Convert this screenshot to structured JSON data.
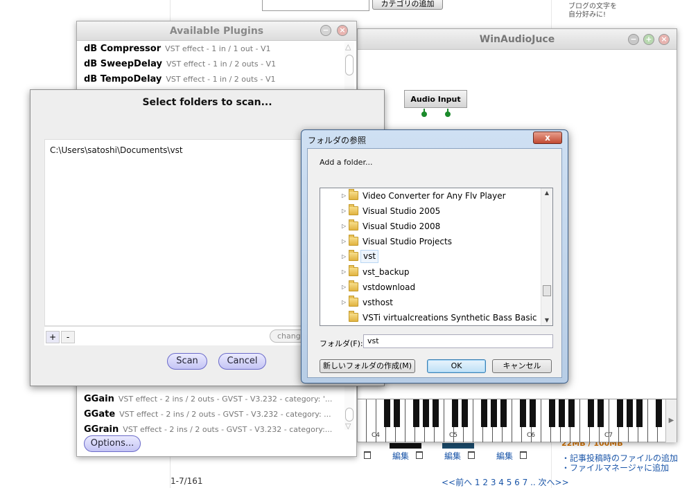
{
  "background_page": {
    "category_button": "カテゴリの追加",
    "ad_text_line1": "ブログの文字を",
    "ad_text_line2": "自分好みに!",
    "storage_text": "22MB / 100MB",
    "links": [
      "・記事投稿時のファイルの追加",
      "・ファイルマネージャに追加"
    ],
    "pager_count": "1-7/161",
    "pager": "<<前へ 1 2 3 4 5 6 7 .. 次へ>>",
    "edit_label": "編集"
  },
  "main_window": {
    "title": "WinAudioJuce",
    "audio_node_label": "Audio Input",
    "octave_labels": [
      "C4",
      "C5",
      "C6",
      "C7"
    ]
  },
  "plugins_window": {
    "title": "Available Plugins",
    "rows_top": [
      {
        "name": "dB Compressor",
        "desc": "VST effect - 1 in / 1 out - V1"
      },
      {
        "name": "dB SweepDelay",
        "desc": "VST effect - 1 in / 2 outs - V1"
      },
      {
        "name": "dB TempoDelay",
        "desc": "VST effect - 1 in / 2 outs - V1"
      }
    ],
    "rows_bottom": [
      {
        "name": "GGain",
        "desc": "VST effect - 2 ins / 2 outs - GVST - V3.232 - category: '..."
      },
      {
        "name": "GGate",
        "desc": "VST effect - 2 ins / 2 outs - GVST - V3.232 - category: ..."
      },
      {
        "name": "GGrain",
        "desc": "VST effect - 2 ins / 2 outs - GVST - V3.232 - category:..."
      }
    ],
    "options_button": "Options..."
  },
  "scan_dialog": {
    "title": "Select folders to scan...",
    "paths": [
      "C:\\Users\\satoshi\\Documents\\vst"
    ],
    "add_button": "+",
    "remove_button": "-",
    "change_button": "change...",
    "scan_button": "Scan",
    "cancel_button": "Cancel"
  },
  "browse_dialog": {
    "title": "フォルダの参照",
    "close_label": "x",
    "caption": "Add a folder...",
    "tree_items": [
      {
        "label": "Video Converter for Any Flv Player",
        "expandable": true,
        "selected": false
      },
      {
        "label": "Visual Studio 2005",
        "expandable": true,
        "selected": false
      },
      {
        "label": "Visual Studio 2008",
        "expandable": true,
        "selected": false
      },
      {
        "label": "Visual Studio Projects",
        "expandable": true,
        "selected": false
      },
      {
        "label": "vst",
        "expandable": true,
        "selected": true
      },
      {
        "label": "vst_backup",
        "expandable": true,
        "selected": false
      },
      {
        "label": "vstdownload",
        "expandable": true,
        "selected": false
      },
      {
        "label": "vsthost",
        "expandable": true,
        "selected": false
      },
      {
        "label": "VSTi virtualcreations Synthetic Bass Basic",
        "expandable": false,
        "selected": false
      }
    ],
    "folder_field_label": "フォルダ(F):",
    "folder_field_value": "vst",
    "new_folder_button": "新しいフォルダの作成(M)",
    "ok_button": "OK",
    "cancel_button": "キャンセル"
  },
  "colors": {
    "pill_button": "#c4c4f4",
    "node_pin": "#1a8a2a",
    "close_red": "#c24a32"
  }
}
